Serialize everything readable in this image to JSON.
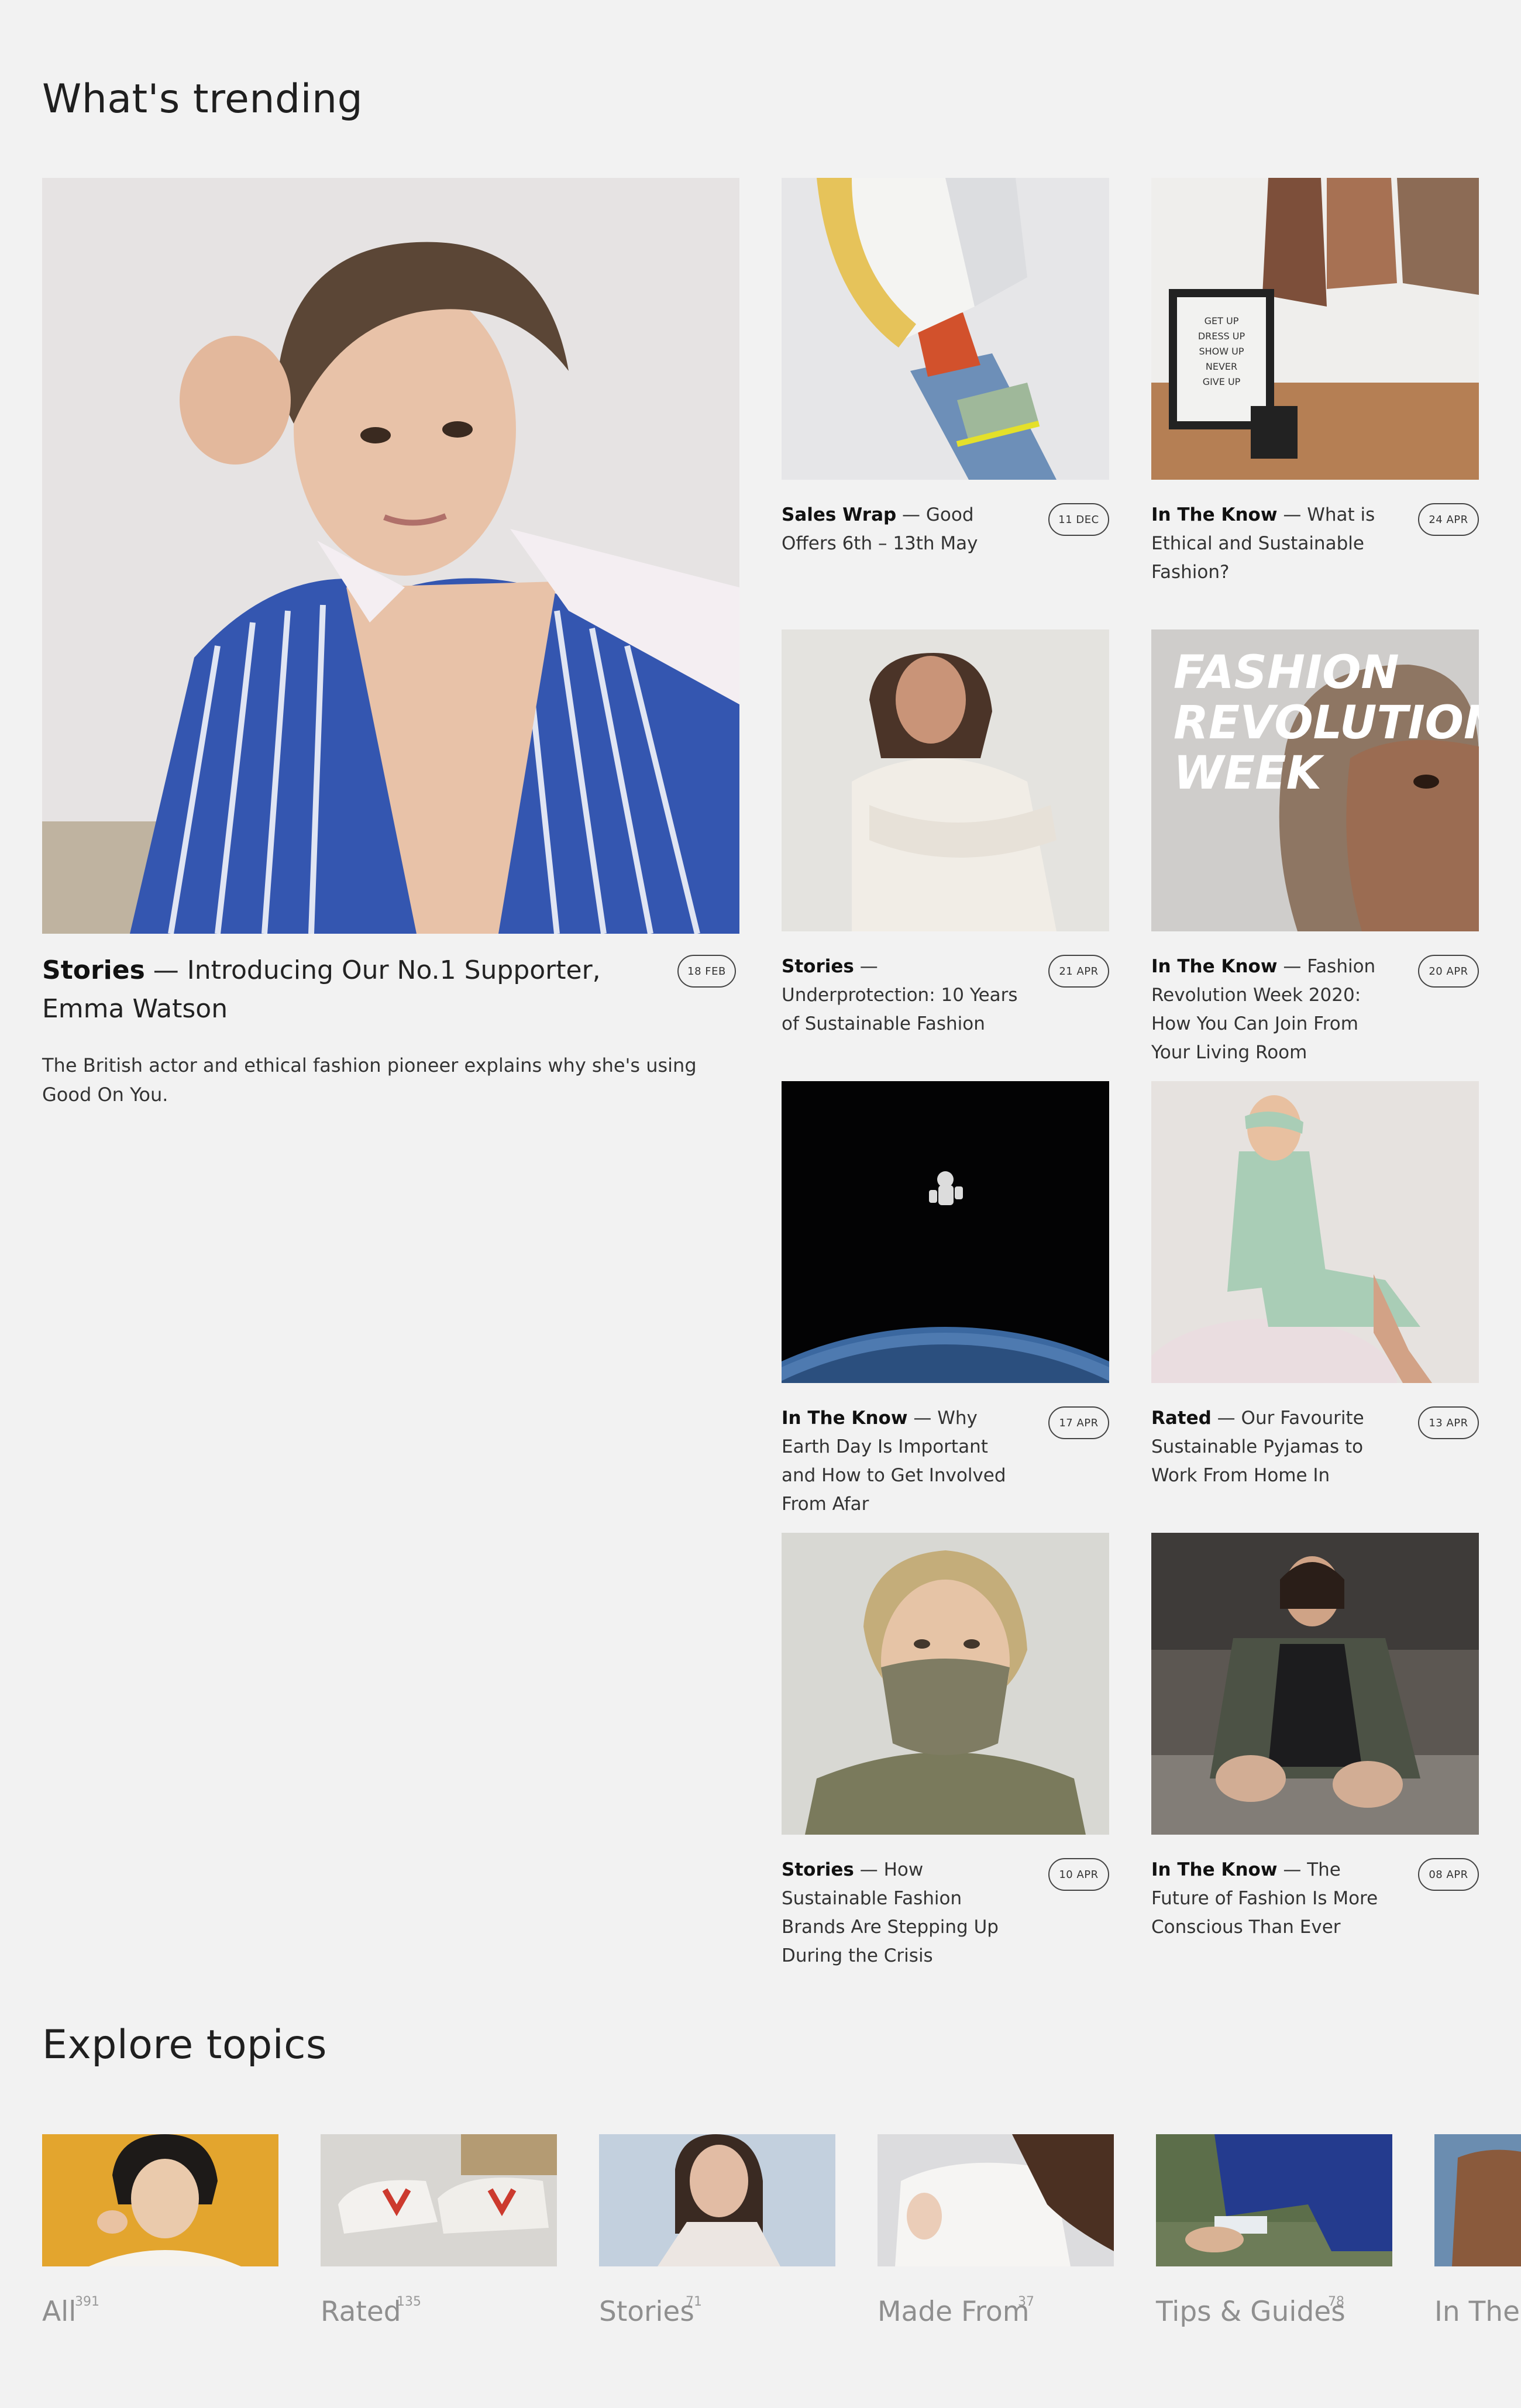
{
  "trending": {
    "title": "What's trending",
    "feature": {
      "category": "Stories",
      "separator": " — ",
      "title": "Introducing Our No.1 Supporter, Emma Watson",
      "date": "18 FEB",
      "description": "The British actor and ethical fashion pioneer explains why she's using Good On You."
    },
    "cards": [
      {
        "category": "Sales Wrap",
        "title": "Good Offers 6th – 13th May",
        "date": "11 DEC"
      },
      {
        "category": "In The Know",
        "title": "What is Ethical and Sustainable Fashion?",
        "date": "24 APR",
        "image_text": "GET UP\nDRESS UP\nSHOW UP\nNEVER\nGIVE UP"
      },
      {
        "category": "Stories",
        "title": "Underprotection: 10 Years of Sustainable Fashion",
        "date": "21 APR"
      },
      {
        "category": "In The Know",
        "title": "Fashion Revolution Week 2020: How You Can Join From Your Living Room",
        "date": "20 APR",
        "image_text": "FASHION\nREVOLUTION\nWEEK"
      },
      {
        "category": "In The Know",
        "title": "Why Earth Day Is Important and How to Get Involved From Afar",
        "date": "17 APR"
      },
      {
        "category": "Rated",
        "title": "Our Favourite Sustainable Pyjamas to Work From Home In",
        "date": "13 APR"
      },
      {
        "category": "Stories",
        "title": "How Sustainable Fashion Brands Are Stepping Up During the Crisis",
        "date": "10 APR"
      },
      {
        "category": "In The Know",
        "title": "The Future of Fashion Is More Conscious Than Ever",
        "date": "08 APR"
      }
    ]
  },
  "explore": {
    "title": "Explore topics",
    "topics": [
      {
        "label": "All",
        "count": "391"
      },
      {
        "label": "Rated",
        "count": "135"
      },
      {
        "label": "Stories",
        "count": "71"
      },
      {
        "label": "Made From",
        "count": "37"
      },
      {
        "label": "Tips & Guides",
        "count": "78"
      },
      {
        "label": "In The",
        "count": ""
      }
    ]
  },
  "colors": {
    "background": "#f2f2f2",
    "text": "#222222",
    "muted": "#8f8f8f"
  }
}
